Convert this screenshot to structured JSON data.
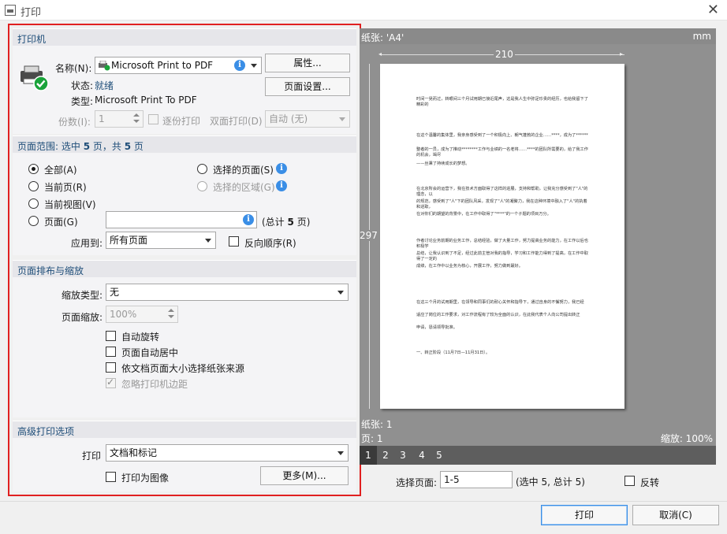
{
  "window": {
    "title": "打印"
  },
  "printer": {
    "section": "打印机",
    "name_label": "名称(N):",
    "name_value": "Microsoft Print to PDF",
    "properties_btn": "属性...",
    "status_label": "状态:",
    "status_value": "就绪",
    "type_label": "类型:",
    "type_value": "Microsoft Print To PDF",
    "page_setup_btn": "页面设置...",
    "copies_label": "份数(I):",
    "copies_value": "1",
    "collate_label": "逐份打印",
    "duplex_label": "双面打印(D)",
    "duplex_value": "自动 (无)"
  },
  "range": {
    "section_prefix": "页面范围: 选中",
    "selected": "5",
    "mid": "页，共",
    "total": "5",
    "suffix": "页",
    "all": "全部(A)",
    "current_page": "当前页(R)",
    "current_view": "当前视图(V)",
    "pages": "页面(G)",
    "selected_pages": "选择的页面(S)",
    "selected_area": "选择的区域(G)",
    "total_prefix": "(总计",
    "total_count": "5",
    "total_suffix": "页)",
    "apply_label": "应用到:",
    "apply_value": "所有页面",
    "reverse_label": "反向顺序(R)"
  },
  "layout": {
    "section": "页面排布与缩放",
    "scale_type_label": "缩放类型:",
    "scale_type_value": "无",
    "zoom_label": "页面缩放:",
    "zoom_value": "100%",
    "auto_rotate": "自动旋转",
    "auto_center": "页面自动居中",
    "fit_paper": "依文档页面大小选择纸张来源",
    "ignore_margin": "忽略打印机边距"
  },
  "advanced": {
    "section": "高级打印选项",
    "print_label": "打印",
    "print_value": "文档和标记",
    "as_image": "打印为图像",
    "more_btn": "更多(M)..."
  },
  "preview": {
    "paper_label": "纸张: 'A4'",
    "unit": "mm",
    "width": "210",
    "height": "297",
    "sheets_label": "纸张: 1",
    "pages_label": "页: 1",
    "zoom_label": "缩放: 100%",
    "thumbs": [
      "1",
      "2",
      "3",
      "4",
      "5"
    ],
    "doc_lines": [
      "时间一晃而过，转眼间三个月试用期已接近尾声，这是我人生中弥足珍贵的经历，也给我留下了精彩的",
      "在这个温馨的集体里，我亲身感受到了一个积极向上、朝气蓬勃的企业……****，成为了******",
      "整者的一员，成为了推动********工作与业绩的一名老将……****的团队所需要的，给了我工作的机会，竭尽",
      "——丝秉了持续成长的梦想。",
      "在北京所会的运营下，我在技术方面取得了这样的进展，支持和帮助，让我充分感受到了\"人\"的理念，以",
      "的规范，感受到了\"人\"下的团队风采，发现了\"人\"的凝聚力，我在这种环境中融入了\"人\"的执着和进取，",
      "在对你们的期望的背景中，在工作中取得了\"****\"的一个子题的项目万分。",
      "作者讨论业务前期的业务工作，总结经验，做了大量工作，努力提高业务的能力，在工作以后也积极学",
      "总结，让我认识到了不足，经过此前主管对我的指导，学习和工作能力得到了提高，在工作中取得了一定的",
      "成绩，在工作中以业务为核心，开展工作，努力做到最好。",
      "在这三个月的试用期里，在领导和同事们的耐心关怀和指导下，通过自身的不懈努力，我已经",
      "适应了岗位的工作要求，对工作流程有了较为全面的认识，在此我代表个人向公司提出转正",
      "申请，恳请领导批准。",
      "一、转正阶段（11月7日—11月31日）。"
    ]
  },
  "bottom": {
    "select_label": "选择页面:",
    "select_value": "1-5",
    "select_info": "(选中 5, 总计 5)",
    "flip_label": "反转",
    "print_btn": "打印",
    "cancel_btn": "取消(C)"
  }
}
